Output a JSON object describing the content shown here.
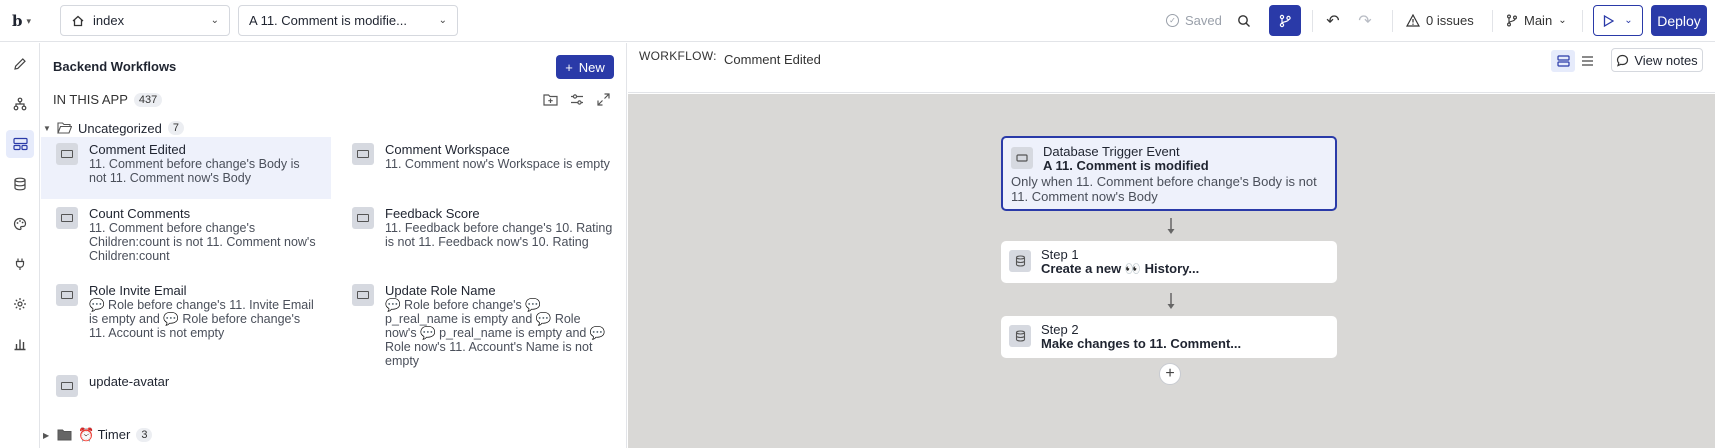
{
  "topbar": {
    "logo": "b",
    "page_select": "index",
    "workflow_select": "A 11. Comment is modifie...",
    "saved": "Saved",
    "issues": "0 issues",
    "branch": "Main",
    "deploy": "Deploy"
  },
  "panel": {
    "title": "Backend Workflows",
    "new_button": "New",
    "in_app_label": "IN THIS APP",
    "in_app_count": "437",
    "folders": [
      {
        "name": "Uncategorized",
        "count": "7"
      },
      {
        "name": "⏰ Timer",
        "count": "3"
      }
    ],
    "workflows": [
      {
        "name": "Comment Edited",
        "desc": "11. Comment before change's Body is not 11. Comment now's Body"
      },
      {
        "name": "Comment Workspace",
        "desc": "11. Comment now's Workspace is empty"
      },
      {
        "name": "Count Comments",
        "desc": "11. Comment before change's Children:count is not 11. Comment now's Children:count"
      },
      {
        "name": "Feedback Score",
        "desc": "11. Feedback before change's 10. Rating is not 11. Feedback now's 10. Rating"
      },
      {
        "name": "Role Invite Email",
        "desc": "💬 Role before change's 11. Invite Email is empty and 💬 Role before change's 11. Account is not empty"
      },
      {
        "name": "Update Role Name",
        "desc": "💬 Role before change's 💬 p_real_name is empty and 💬 Role now's 💬 p_real_name is empty and 💬 Role now's 11. Account's Name is not empty"
      },
      {
        "name": "update-avatar",
        "desc": ""
      }
    ]
  },
  "main": {
    "workflow_label": "WORKFLOW:",
    "workflow_name": "Comment Edited",
    "view_notes": "View notes",
    "trigger": {
      "type": "Database Trigger Event",
      "title": "A 11. Comment is modified",
      "condition": "Only when 11. Comment before change's Body is not 11. Comment now's Body"
    },
    "steps": [
      {
        "label": "Step 1",
        "action": "Create a new 👀 History..."
      },
      {
        "label": "Step 2",
        "action": "Make changes to 11. Comment..."
      }
    ]
  },
  "colors": {
    "accent": "#2a3aa8",
    "canvas": "#d9d8d6",
    "selected": "#eef1fb"
  }
}
